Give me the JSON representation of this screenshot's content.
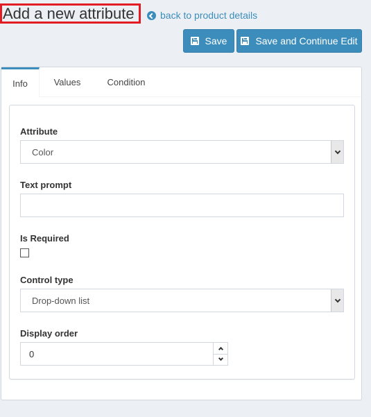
{
  "header": {
    "title": "Add a new attribute",
    "back_link": "back to product details"
  },
  "toolbar": {
    "save_label": "Save",
    "save_continue_label": "Save and Continue Edit"
  },
  "tabs": [
    {
      "label": "Info",
      "active": true
    },
    {
      "label": "Values",
      "active": false
    },
    {
      "label": "Condition",
      "active": false
    }
  ],
  "form": {
    "attribute": {
      "label": "Attribute",
      "value": "Color"
    },
    "text_prompt": {
      "label": "Text prompt",
      "value": ""
    },
    "is_required": {
      "label": "Is Required",
      "checked": false
    },
    "control_type": {
      "label": "Control type",
      "value": "Drop-down list"
    },
    "display_order": {
      "label": "Display order",
      "value": "0"
    }
  },
  "colors": {
    "accent": "#3c8dbc",
    "highlight_border": "#e31b23",
    "background": "#ecf0f5"
  },
  "icons": {
    "back": "arrow-circle-left-icon",
    "save": "floppy-disk-icon"
  }
}
